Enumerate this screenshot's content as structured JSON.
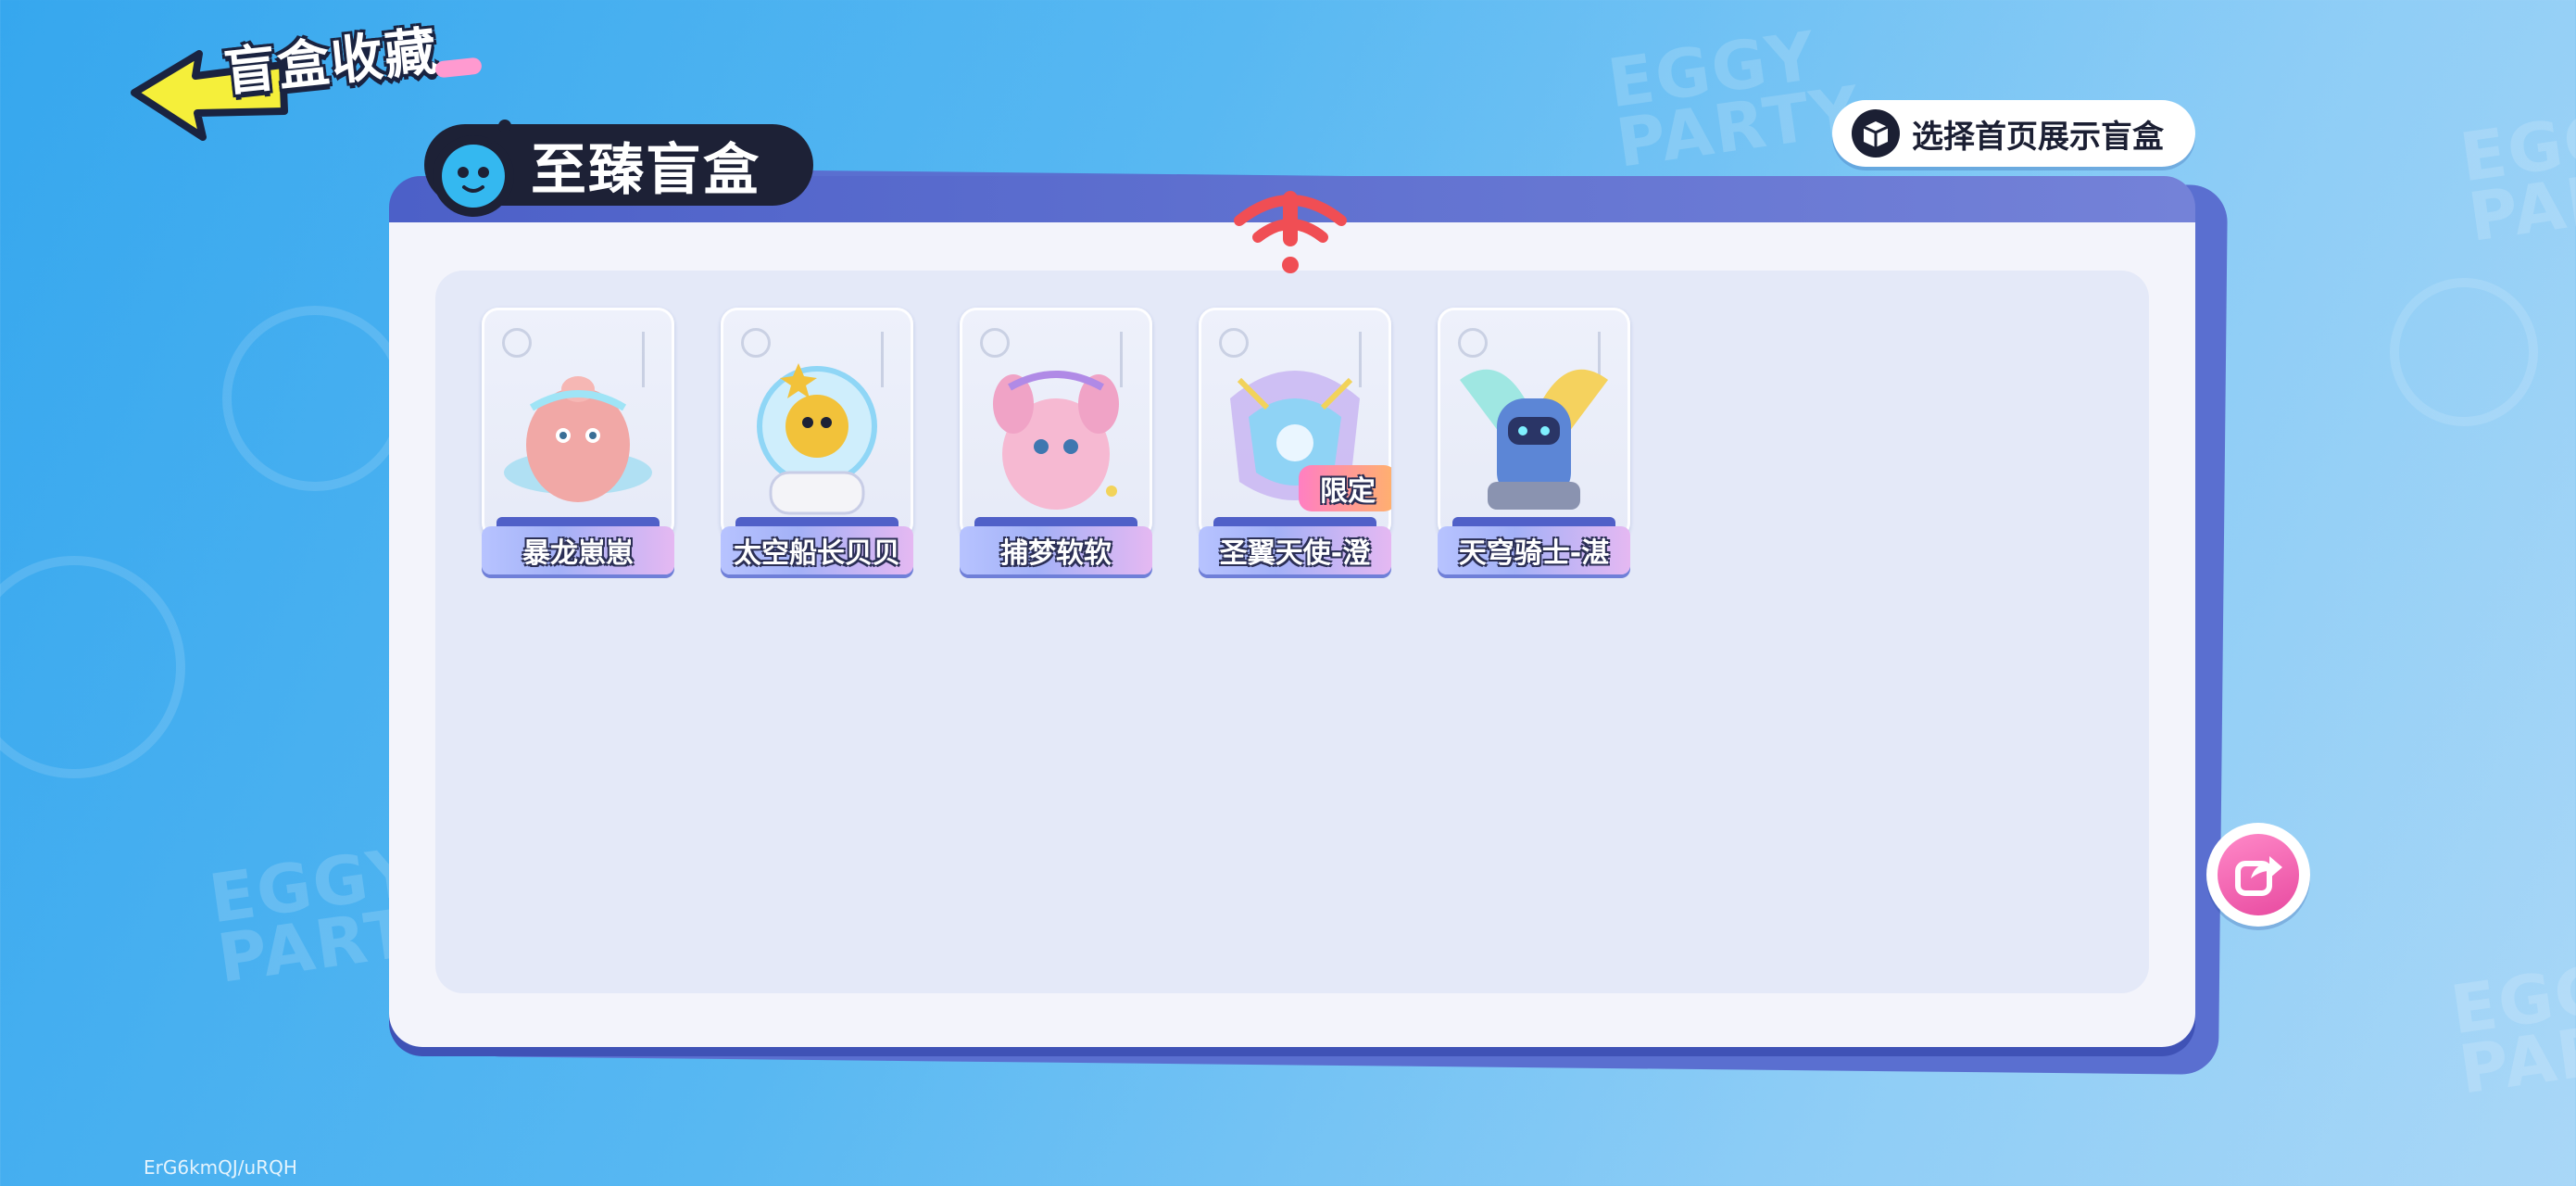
{
  "header": {
    "title": "盲盒收藏",
    "back_icon": "back-arrow-icon"
  },
  "showcase_button": {
    "label": "选择首页展示盲盒",
    "icon": "box-icon"
  },
  "section": {
    "title": "至臻盲盒",
    "mascot_icon": "eggy-mascot-icon",
    "alert_icon": "signal-warning-icon"
  },
  "cards": [
    {
      "name": "暴龙崽崽",
      "limited": false
    },
    {
      "name": "太空船长贝贝",
      "limited": false
    },
    {
      "name": "捕梦软软",
      "limited": false
    },
    {
      "name": "圣翼天使-澄",
      "limited": true,
      "badge": "限定"
    },
    {
      "name": "天穹骑士-湛",
      "limited": false
    }
  ],
  "share_button": {
    "icon": "share-icon"
  },
  "footer": {
    "uid": "ErG6kmQJ/uRQH"
  },
  "colors": {
    "background": "#49b1f0",
    "panel": "#f3f4fb",
    "panel_header": "#4c60c8",
    "badge_dark": "#1d2136",
    "limited_badge": "#ff7fc2",
    "share_pink": "#e84aa0"
  }
}
